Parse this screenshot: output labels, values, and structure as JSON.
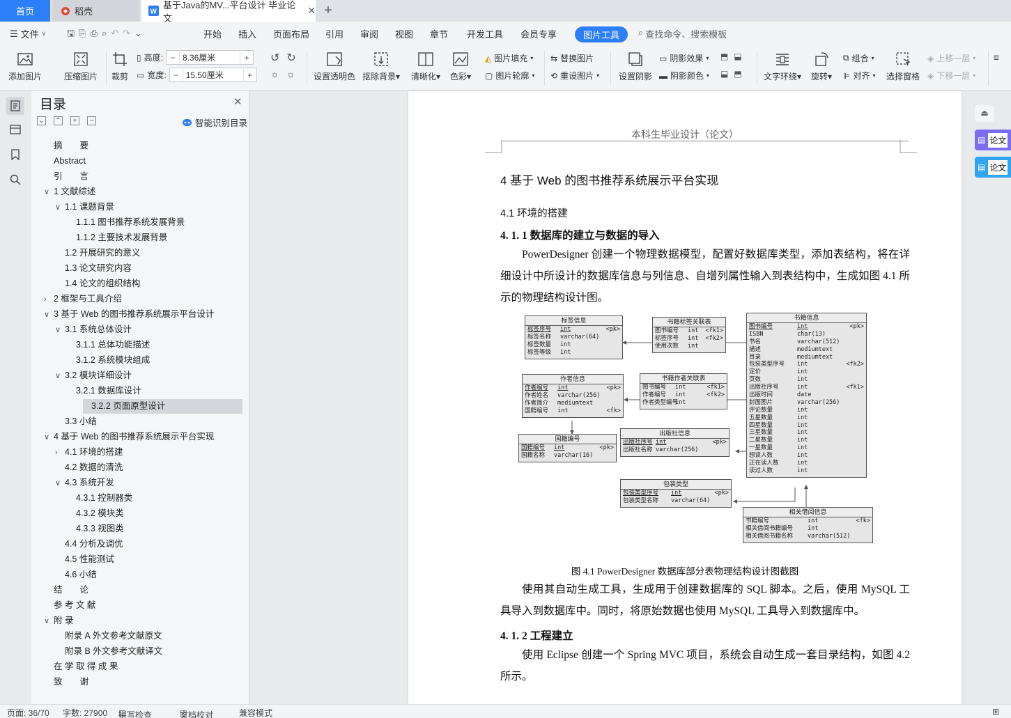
{
  "tabs": {
    "home": "首页",
    "daoke": "稻壳",
    "doc": "基于Java的MV...平台设计 毕业论文"
  },
  "menu": {
    "file": "文件",
    "items": [
      "开始",
      "插入",
      "页面布局",
      "引用",
      "审阅",
      "视图",
      "章节",
      "开发工具",
      "会员专享"
    ],
    "active_tab": "图片工具",
    "search": "查找命令、搜索模板"
  },
  "ribbon": {
    "add_image": "添加图片",
    "compress": "压缩图片",
    "crop": "裁剪",
    "height_label": "高度:",
    "height_value": "8.36厘米",
    "width_label": "宽度:",
    "width_value": "15.50厘米",
    "transparent": "设置透明色",
    "remove_bg": "抠除背景",
    "sharpen": "清晰化",
    "color": "色彩",
    "fill": "图片填充",
    "outline": "图片轮廓",
    "replace": "替换图片",
    "reset": "重设图片",
    "shadow": "设置阴影",
    "shadow_effect": "阴影效果",
    "shadow_color": "阴影颜色",
    "wrap": "文字环绕",
    "rotate": "旋转",
    "group": "组合",
    "align": "对齐",
    "select_pane": "选择窗格",
    "bring_forward": "上移一层",
    "send_backward": "下移一层"
  },
  "toc": {
    "title": "目录",
    "smart": "智能识别目录",
    "items": [
      {
        "label": "摘　　要",
        "level": 0,
        "chev": ""
      },
      {
        "label": "Abstract",
        "level": 0,
        "chev": ""
      },
      {
        "label": "引　　言",
        "level": 0,
        "chev": ""
      },
      {
        "label": "1  文献综述",
        "level": 0,
        "chev": "v"
      },
      {
        "label": "1.1  课题背景",
        "level": 1,
        "chev": "v"
      },
      {
        "label": "1.1.1  图书推荐系统发展背景",
        "level": 2,
        "chev": ""
      },
      {
        "label": "1.1.2  主要技术发展背景",
        "level": 2,
        "chev": ""
      },
      {
        "label": "1.2  开展研究的意义",
        "level": 1,
        "chev": ""
      },
      {
        "label": "1.3  论文研究内容",
        "level": 1,
        "chev": ""
      },
      {
        "label": "1.4  论文的组织结构",
        "level": 1,
        "chev": ""
      },
      {
        "label": "2  框架与工具介绍",
        "level": 0,
        "chev": ">"
      },
      {
        "label": "3  基于 Web 的图书推荐系统展示平台设计",
        "level": 0,
        "chev": "v"
      },
      {
        "label": "3.1  系统总体设计",
        "level": 1,
        "chev": "v"
      },
      {
        "label": "3.1.1  总体功能描述",
        "level": 2,
        "chev": ""
      },
      {
        "label": "3.1.2  系统模块组成",
        "level": 2,
        "chev": ""
      },
      {
        "label": "3.2  模块详细设计",
        "level": 1,
        "chev": "v"
      },
      {
        "label": "3.2.1  数据库设计",
        "level": 2,
        "chev": ""
      },
      {
        "label": "3.2.2  页面原型设计",
        "level": 2,
        "chev": "",
        "active": true
      },
      {
        "label": "3.3  小结",
        "level": 1,
        "chev": ""
      },
      {
        "label": "4  基于 Web 的图书推荐系统展示平台实现",
        "level": 0,
        "chev": "v"
      },
      {
        "label": "4.1  环境的搭建",
        "level": 1,
        "chev": ">"
      },
      {
        "label": "4.2  数据的清洗",
        "level": 1,
        "chev": ""
      },
      {
        "label": "4.3  系统开发",
        "level": 1,
        "chev": "v"
      },
      {
        "label": "4.3.1  控制器类",
        "level": 2,
        "chev": ""
      },
      {
        "label": "4.3.2  模块类",
        "level": 2,
        "chev": ""
      },
      {
        "label": "4.3.3  视图类",
        "level": 2,
        "chev": ""
      },
      {
        "label": "4.4  分析及调优",
        "level": 1,
        "chev": ""
      },
      {
        "label": "4.5  性能测试",
        "level": 1,
        "chev": ""
      },
      {
        "label": "4.6  小结",
        "level": 1,
        "chev": ""
      },
      {
        "label": "结　　论",
        "level": 0,
        "chev": ""
      },
      {
        "label": "参 考 文 献",
        "level": 0,
        "chev": ""
      },
      {
        "label": "附  录",
        "level": 0,
        "chev": "v"
      },
      {
        "label": "附录 A  外文参考文献原文",
        "level": 1,
        "chev": ""
      },
      {
        "label": "附录 B  外文参考文献译文",
        "level": 1,
        "chev": ""
      },
      {
        "label": "在 学 取 得 成 果",
        "level": 0,
        "chev": ""
      },
      {
        "label": "致　　谢",
        "level": 0,
        "chev": ""
      }
    ]
  },
  "page": {
    "header": "本科生毕业设计（论文）",
    "h1": "4  基于 Web 的图书推荐系统展示平台实现",
    "h2": "4.1  环境的搭建",
    "h3_1": "4. 1. 1 数据库的建立与数据的导入",
    "p1": "PowerDesigner 创建一个物理数据模型，配置好数据库类型，添加表结构，将在详细设计中所设计的数据库信息与列信息、自增列属性输入到表结构中，生成如图 4.1 所示的物理结构设计图。",
    "caption": "图 4.1 PowerDesigner 数据库部分表物理结构设计图截图",
    "p2": "使用其自动生成工具，生成用于创建数据库的 SQL 脚本。之后，使用 MySQL 工具导入到数据库中。同时，将原始数据也使用 MySQL 工具导入到数据库中。",
    "h3_2": "4. 1. 2 工程建立",
    "p3": "使用 Eclipse 创建一个 Spring MVC 项目，系统会自动生成一套目录结构，如图 4.2 所示。"
  },
  "erd": {
    "tag": {
      "title": "标签信息",
      "rows": [
        [
          "标签序号",
          "int",
          "<pk>"
        ],
        [
          "标签名称",
          "varchar(64)",
          ""
        ],
        [
          "标签数量",
          "int",
          ""
        ],
        [
          "标签等级",
          "int",
          ""
        ]
      ]
    },
    "booktag": {
      "title": "书籍标签关联表",
      "rows": [
        [
          "图书编号",
          "int",
          "<fk1>"
        ],
        [
          "标签序号",
          "int",
          "<fk2>"
        ],
        [
          "使用次数",
          "int",
          ""
        ]
      ]
    },
    "book": {
      "title": "书籍信息",
      "rows": [
        [
          "图书编号",
          "int",
          "<pk>"
        ],
        [
          "ISBN",
          "char(13)",
          ""
        ],
        [
          "书名",
          "varchar(512)",
          ""
        ],
        [
          "描述",
          "mediumtext",
          ""
        ],
        [
          "目录",
          "mediumtext",
          ""
        ],
        [
          "包装类型序号",
          "int",
          "<fk2>"
        ],
        [
          "定价",
          "int",
          ""
        ],
        [
          "页数",
          "int",
          ""
        ],
        [
          "出版社序号",
          "int",
          "<fk1>"
        ],
        [
          "出版时间",
          "date",
          ""
        ],
        [
          "封面图片",
          "varchar(256)",
          ""
        ],
        [
          "评论数量",
          "int",
          ""
        ],
        [
          "五星数量",
          "int",
          ""
        ],
        [
          "四星数量",
          "int",
          ""
        ],
        [
          "三星数量",
          "int",
          ""
        ],
        [
          "二星数量",
          "int",
          ""
        ],
        [
          "一星数量",
          "int",
          ""
        ],
        [
          "想读人数",
          "int",
          ""
        ],
        [
          "正在读人数",
          "int",
          ""
        ],
        [
          "读过人数",
          "int",
          ""
        ]
      ]
    },
    "author": {
      "title": "作者信息",
      "rows": [
        [
          "作者编号",
          "int",
          "<pk>"
        ],
        [
          "作者姓名",
          "varchar(256)",
          ""
        ],
        [
          "作者简介",
          "mediumtext",
          ""
        ],
        [
          "国籍编号",
          "int",
          "<fk>"
        ]
      ]
    },
    "bookauthor": {
      "title": "书籍作者关联表",
      "rows": [
        [
          "图书编号",
          "int",
          "<fk1>"
        ],
        [
          "作者编号",
          "int",
          "<fk2>"
        ],
        [
          "作者类型编号",
          "int",
          ""
        ]
      ]
    },
    "nation": {
      "title": "国籍编号",
      "rows": [
        [
          "国籍编号",
          "int",
          "<pk>"
        ],
        [
          "国籍名称",
          "varchar(16)",
          ""
        ]
      ]
    },
    "publisher": {
      "title": "出版社信息",
      "rows": [
        [
          "出版社序号",
          "int",
          "<pk>"
        ],
        [
          "出版社名称",
          "varchar(256)",
          ""
        ]
      ]
    },
    "pack": {
      "title": "包装类型",
      "rows": [
        [
          "包装类型序号",
          "int",
          "<pk>"
        ],
        [
          "包装类型名称",
          "varchar(64)",
          ""
        ]
      ]
    },
    "related": {
      "title": "相关借阅信息",
      "rows": [
        [
          "书籍编号",
          "int",
          "<fk>"
        ],
        [
          "相关借阅书籍编号",
          "int",
          ""
        ],
        [
          "相关借阅书籍名称",
          "varchar(512)",
          ""
        ]
      ]
    }
  },
  "rightrail": {
    "item1": "论文",
    "item2": "论文"
  },
  "status": {
    "page": "页面: 36/70",
    "words": "字数: 27900",
    "spell": "拼写检查",
    "proof": "文档校对",
    "compat": "兼容模式"
  },
  "colors": {
    "accent": "#2d7ff9",
    "active_toc": "#d3d6db"
  }
}
